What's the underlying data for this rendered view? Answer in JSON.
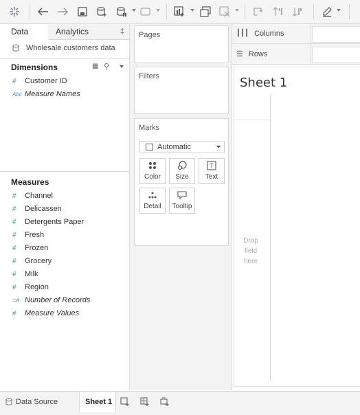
{
  "toolbar": {
    "icons": [
      "tableau-logo-icon",
      "undo-icon",
      "redo-icon",
      "save-icon",
      "new-datasource-icon",
      "pause-updates-icon",
      "run-update-icon",
      "new-worksheet-icon",
      "duplicate-icon",
      "clear-sheet-icon",
      "swap-icon",
      "sort-ascending-icon",
      "sort-descending-icon",
      "highlight-icon"
    ]
  },
  "data_pane": {
    "tabs": {
      "data": "Data",
      "analytics": "Analytics"
    },
    "datasource": "Wholesale customers data",
    "dimensions_title": "Dimensions",
    "dimensions": [
      {
        "icon": "#",
        "label": "Customer ID",
        "italic": false
      },
      {
        "icon": "Abc",
        "label": "Measure Names",
        "italic": true
      }
    ],
    "measures_title": "Measures",
    "measures": [
      {
        "icon": "#",
        "label": "Channel",
        "italic": false
      },
      {
        "icon": "#",
        "label": "Delicassen",
        "italic": false
      },
      {
        "icon": "#",
        "label": "Detergents Paper",
        "italic": false
      },
      {
        "icon": "#",
        "label": "Fresh",
        "italic": false
      },
      {
        "icon": "#",
        "label": "Frozen",
        "italic": false
      },
      {
        "icon": "#",
        "label": "Grocery",
        "italic": false
      },
      {
        "icon": "#",
        "label": "Milk",
        "italic": false
      },
      {
        "icon": "#",
        "label": "Region",
        "italic": false
      },
      {
        "icon": "=#",
        "label": "Number of Records",
        "italic": true
      },
      {
        "icon": "#",
        "label": "Measure Values",
        "italic": true
      }
    ]
  },
  "cards": {
    "pages": "Pages",
    "filters": "Filters",
    "marks": "Marks",
    "mark_type": "Automatic",
    "buttons": {
      "color": "Color",
      "size": "Size",
      "text": "Text",
      "detail": "Detail",
      "tooltip": "Tooltip"
    }
  },
  "shelves": {
    "columns": "Columns",
    "rows": "Rows"
  },
  "sheet": {
    "title": "Sheet 1",
    "drop_hint": [
      "Drop",
      "field",
      "here"
    ]
  },
  "bottom": {
    "data_source": "Data Source",
    "sheet_tab": "Sheet 1"
  }
}
